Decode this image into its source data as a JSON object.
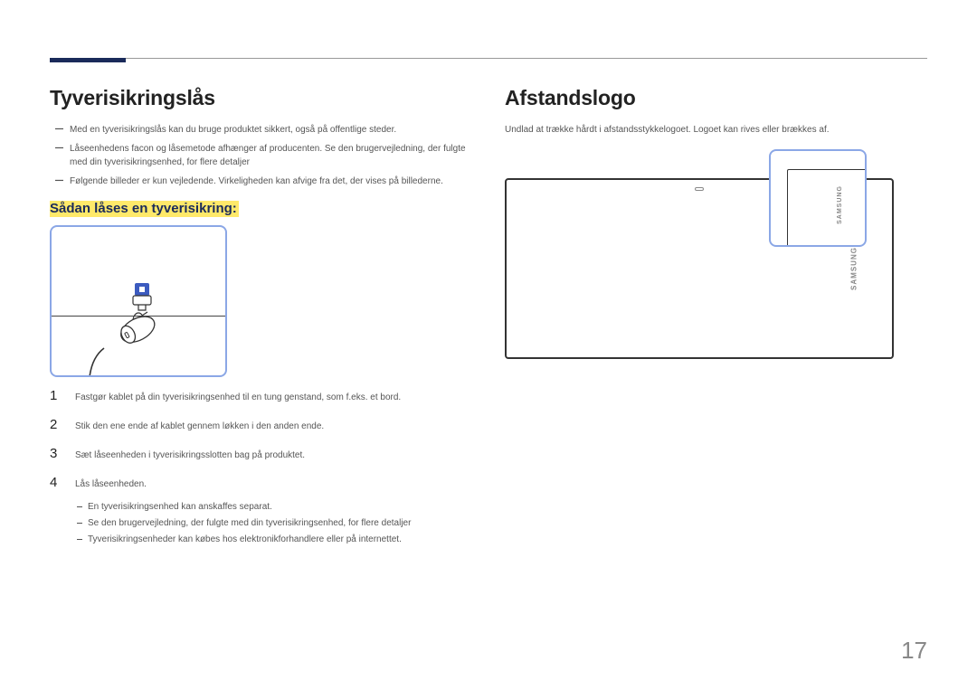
{
  "page_number": "17",
  "left": {
    "heading": "Tyverisikringslås",
    "notes": [
      "Med en tyverisikringslås kan du bruge produktet sikkert, også på offentlige steder.",
      "Låseenhedens facon og låsemetode afhænger af producenten. Se den brugervejledning, der fulgte med din tyverisikringsenhed, for flere detaljer",
      "Følgende billeder er kun vejledende. Virkeligheden kan afvige fra det, der vises på billederne."
    ],
    "subheading": "Sådan låses en tyverisikring:",
    "steps": [
      {
        "n": "1",
        "t": "Fastgør kablet på din tyverisikringsenhed til en tung genstand, som f.eks. et bord."
      },
      {
        "n": "2",
        "t": "Stik den ene ende af kablet gennem løkken i den anden ende."
      },
      {
        "n": "3",
        "t": "Sæt låseenheden i tyverisikringsslotten bag på produktet."
      },
      {
        "n": "4",
        "t": "Lås låseenheden."
      }
    ],
    "post_notes": [
      "En tyverisikringsenhed kan anskaffes separat.",
      "Se den brugervejledning, der fulgte med din tyverisikringsenhed, for flere detaljer",
      "Tyverisikringsenheder kan købes hos elektronikforhandlere eller på internettet."
    ]
  },
  "right": {
    "heading": "Afstandslogo",
    "body": "Undlad at trække hårdt i afstandsstykkelogoet. Logoet kan rives eller brækkes af.",
    "brand": "SAMSUNG"
  }
}
